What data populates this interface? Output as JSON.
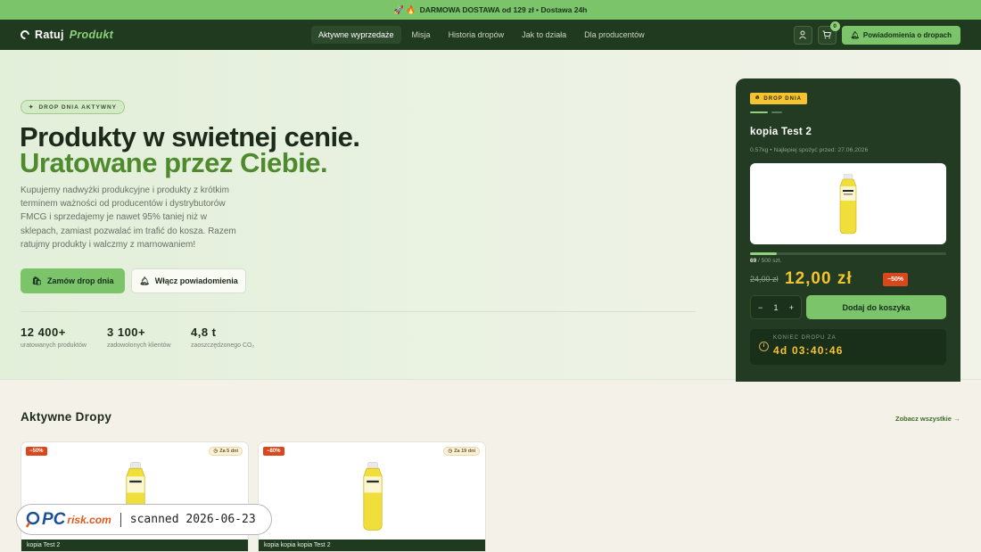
{
  "promo_bar": {
    "icons": "🚀 🔥",
    "text": "DARMOWA DOSTAWA od 129 zł • Dostawa 24h"
  },
  "nav": {
    "logo_word1": "Ratuj",
    "logo_word2": "Produkt",
    "links": [
      "Aktywne wyprzedaże",
      "Misja",
      "Historia dropów",
      "Jak to działa",
      "Dla producentów"
    ],
    "active_link": "Aktywne wyprzedaże",
    "cart_count": "0",
    "notify_label": "Powiadomienia o dropach"
  },
  "hero": {
    "badge": "DROP DNIA AKTYWNY",
    "headline_line1": "Produkty w swietnej cenie.",
    "headline_line2": "Uratowane przez Ciebie.",
    "lead": "Kupujemy nadwyżki produkcyjne i produkty z krótkim terminem ważności od producentów i dystrybutorów FMCG i sprzedajemy je nawet 95% taniej niż w sklepach, zamiast pozwalać im trafić do kosza. Razem ratujmy produkty i walczmy z marnowaniem!",
    "primary_button": "Zamów drop dnia",
    "secondary_button": "Włącz powiadomienia",
    "stats": [
      {
        "value": "12 400+",
        "label": "uratowanych produktów"
      },
      {
        "value": "3 100+",
        "label": "zadowolonych klientów"
      },
      {
        "value": "4,8 t",
        "label": "zaoszczędzonego CO₂"
      }
    ]
  },
  "drop_card": {
    "badge": "DROP DNIA",
    "title": "kopia Test 2",
    "meta": "0.57kg • Najlepiej spożyć przed: 27.06.2026",
    "stock_sold": "69",
    "stock_total": "/ 500 szt.",
    "stock_fraction": 0.138,
    "old_price": "24,00 zł",
    "new_price": "12,00 zł",
    "discount": "−50%",
    "quantity": "1",
    "qty_minus": "−",
    "qty_plus": "+",
    "add_to_cart": "Dodaj do koszyka",
    "countdown_label": "KONIEC DROPU ZA",
    "countdown_time": "4d 03:40:46"
  },
  "active_drops": {
    "title": "Aktywne Dropy",
    "see_all": "Zobacz wszystkie →",
    "items": [
      {
        "discount": "−50%",
        "time": "Za 5 dni",
        "name": "kopia Test 2"
      },
      {
        "discount": "−80%",
        "time": "Za 19 dni",
        "name": "kopia kopia kopia Test 2"
      }
    ]
  },
  "watermark": {
    "brand_main": "PC",
    "brand_suffix": "risk.com",
    "scan_text": "scanned 2026-06-23"
  },
  "colors": {
    "accent_green": "#7cc46a",
    "dark_green": "#1f3a1f",
    "price_yellow": "#f4c430",
    "discount_red": "#d9481c"
  }
}
